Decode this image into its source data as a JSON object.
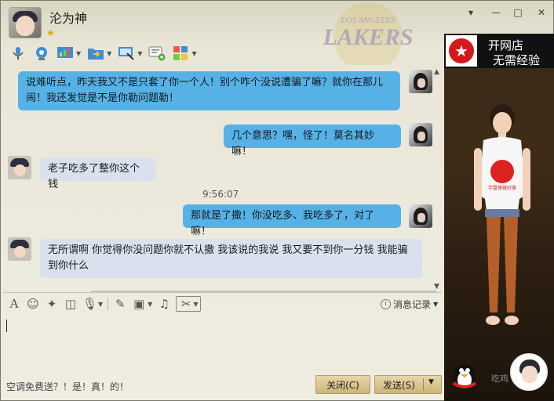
{
  "window": {
    "contact_name": "沦为神",
    "controls": {
      "menu": "▾",
      "minimize": "—",
      "maximize": "□",
      "close": "✕"
    },
    "logo_text_top": "LOS ANGELES",
    "logo_text_main": "LAKERS"
  },
  "toolbar": {
    "items": [
      {
        "icon": "microphone-icon",
        "has_dropdown": false
      },
      {
        "icon": "video-camera-icon",
        "has_dropdown": false
      },
      {
        "icon": "screen-share-icon",
        "has_dropdown": true
      },
      {
        "icon": "file-transfer-icon",
        "has_dropdown": true
      },
      {
        "icon": "remote-desktop-icon",
        "has_dropdown": true
      },
      {
        "icon": "create-discussion-icon",
        "has_dropdown": false
      },
      {
        "icon": "apps-icon",
        "has_dropdown": true
      }
    ]
  },
  "messages": [
    {
      "direction": "out",
      "text_line1": "说难听点，昨天我又不是只套了你一个人！别个咋个没说遭骗了嘛？就你在那儿",
      "text_line2": "闹！我还发觉是不是你勒问题勒！"
    },
    {
      "direction": "out",
      "text": "几个意思？嘿，怪了！莫名其妙嘛！"
    },
    {
      "direction": "in",
      "text": "老子吃多了整你这个钱"
    },
    {
      "direction": "out",
      "text": "那就是了撒！你没吃多、我吃多了，对了嘛！"
    },
    {
      "direction": "in",
      "text_line1": "无所谓啊 你觉得你没问题你就不认撒 我该说的我说 我又要不到你一分钱 我能骗",
      "text_line2": "到你什么"
    }
  ],
  "timestamp": "9:56:07",
  "input_toolbar": {
    "history_label": "消息记录"
  },
  "footer": {
    "promo_text": "空调免费送？！是！真！的！",
    "close_button": "关闭(C)",
    "send_button": "发送(S)"
  },
  "ad": {
    "line1": "开网店",
    "line2": "无需经验",
    "tshirt_text": "学雷锋做好事"
  },
  "watermark": "吃鸡"
}
